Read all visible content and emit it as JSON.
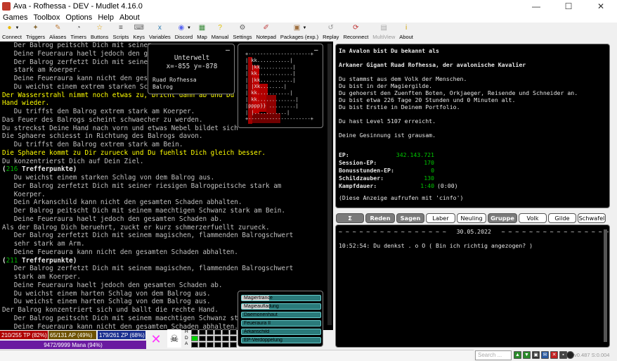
{
  "window": {
    "title": "Ava - Rofhessa - DEV - Mudlet 4.16.0",
    "controls": [
      "—",
      "☐",
      "✕"
    ]
  },
  "menu": [
    "Games",
    "Toolbox",
    "Options",
    "Help",
    "About"
  ],
  "toolbar": [
    {
      "label": "Connect",
      "icon": "plug-icon",
      "color": "#e8b800",
      "glyph": "●",
      "arrow": true
    },
    {
      "label": "Triggers",
      "icon": "trigger-icon",
      "color": "#8a6d3b",
      "glyph": "✦"
    },
    {
      "label": "Aliases",
      "icon": "alias-icon",
      "color": "#c08040",
      "glyph": "✎"
    },
    {
      "label": "Timers",
      "icon": "clock-icon",
      "color": "#555555",
      "glyph": "◔"
    },
    {
      "label": "Buttons",
      "icon": "buttons-icon",
      "color": "#e0a000",
      "glyph": "☆"
    },
    {
      "label": "Scripts",
      "icon": "scripts-icon",
      "color": "#444444",
      "glyph": "≡"
    },
    {
      "label": "Keys",
      "icon": "keys-icon",
      "color": "#6b6b6b",
      "glyph": "⌨"
    },
    {
      "label": "Variables",
      "icon": "variables-icon",
      "color": "#2a7ab0",
      "glyph": "x"
    },
    {
      "label": "Discord",
      "icon": "discord-icon",
      "color": "#5865f2",
      "glyph": "◉",
      "arrow": true
    },
    {
      "label": "Map",
      "icon": "map-icon",
      "color": "#3a8a3a",
      "glyph": "▦"
    },
    {
      "label": "Manual",
      "icon": "manual-icon",
      "color": "#e0c000",
      "glyph": "?"
    },
    {
      "label": "Settings",
      "icon": "settings-icon",
      "color": "#666666",
      "glyph": "⚙"
    },
    {
      "label": "Notepad",
      "icon": "notepad-icon",
      "color": "#c04040",
      "glyph": "✐"
    },
    {
      "label": "Packages (exp.)",
      "icon": "package-icon",
      "color": "#a07040",
      "glyph": "▣",
      "arrow": true
    },
    {
      "label": "Replay",
      "icon": "replay-icon",
      "color": "#999999",
      "glyph": "↺"
    },
    {
      "label": "Reconnect",
      "icon": "reconnect-icon",
      "color": "#c03030",
      "glyph": "⟳"
    },
    {
      "label": "MultiView",
      "icon": "multiview-icon",
      "color": "#aaaaaa",
      "glyph": "▤",
      "dim": true
    },
    {
      "label": "About",
      "icon": "about-icon",
      "color": "#d0a000",
      "glyph": "i"
    }
  ],
  "main_output": [
    {
      "t": "   Der Balrog peitscht Dich mit seinem",
      "c": "gray"
    },
    {
      "t": "   Deine Feueraura haelt jedoch den ges",
      "c": "gray"
    },
    {
      "t": "   Der Balrog zerfetzt Dich mit seinen",
      "c": "gray"
    },
    {
      "t": "   stark am Koerper.",
      "c": "gray"
    },
    {
      "t": "   Deine Feueraura kann nicht den gesam",
      "c": "gray"
    },
    {
      "t": "   Du weichst einem extrem starken Schl",
      "c": "gray"
    },
    {
      "t": "Der Wasserstrahl nimmt noch etwas zu, bricht dann ab und Du s",
      "c": "yellow"
    },
    {
      "t": "Hand wieder.",
      "c": "yellow"
    },
    {
      "t": "   Du triffst den Balrog extrem stark am Koerper.",
      "c": "gray"
    },
    {
      "t": "Das Feuer des Balrogs scheint schwaecher zu werden.",
      "c": "gray"
    },
    {
      "t": "Du streckst Deine Hand nach vorn und etwas Nebel bildet sich",
      "c": "gray"
    },
    {
      "t": "Die Sphaere schiesst in Richtung des Balrogs davon.",
      "c": "gray"
    },
    {
      "t": "   Du triffst den Balrog extrem stark am Bein.",
      "c": "gray"
    },
    {
      "t": "Die Sphaere kommt zu Dir zurueck und Du fuehlst Dich gleich besser.",
      "c": "yellow"
    },
    {
      "t": "Du konzentrierst Dich auf Dein Ziel.",
      "c": "gray"
    },
    {
      "t": "(216 Trefferpunkte)",
      "c": "tp"
    },
    {
      "t": "   Du weichst einem starken Schlag von dem Balrog aus.",
      "c": "gray"
    },
    {
      "t": "   Der Balrog zerfetzt Dich mit seiner riesigen Balrogpeitsche stark am",
      "c": "gray"
    },
    {
      "t": "   Koerper.",
      "c": "gray"
    },
    {
      "t": "   Dein Arkanschild kann nicht den gesamten Schaden abhalten.",
      "c": "gray"
    },
    {
      "t": "   Der Balrog peitscht Dich mit seinem maechtigen Schwanz stark am Bein.",
      "c": "gray"
    },
    {
      "t": "   Deine Feueraura haelt jedoch den gesamten Schaden ab.",
      "c": "gray"
    },
    {
      "t": "Als der Balrog Dich beruehrt, zuckt er kurz schmerzerfuellt zurueck.",
      "c": "gray"
    },
    {
      "t": "   Der Balrog zerfetzt Dich mit seinem magischen, flammenden Balrogschwert",
      "c": "gray"
    },
    {
      "t": "   sehr stark am Arm.",
      "c": "gray"
    },
    {
      "t": "   Deine Feueraura kann nicht den gesamten Schaden abhalten.",
      "c": "gray"
    },
    {
      "t": "(211 Trefferpunkte)",
      "c": "tp"
    },
    {
      "t": "   Der Balrog zerfetzt Dich mit seinem magischen, flammenden Balrogschwert",
      "c": "gray"
    },
    {
      "t": "   stark am Koerper.",
      "c": "gray"
    },
    {
      "t": "   Deine Feueraura haelt jedoch den gesamten Schaden ab.",
      "c": "gray"
    },
    {
      "t": "   Du weichst einem harten Schlag von dem Balrog aus.",
      "c": "gray"
    },
    {
      "t": "   Du weichst einem harten Schlag von dem Balrog aus.",
      "c": "gray"
    },
    {
      "t": "Der Balrog konzentriert sich und ballt die rechte Hand.",
      "c": "gray"
    },
    {
      "t": "   Der Balrog peitscht Dich mit seinem maechtigen Schwanz sta",
      "c": "gray"
    },
    {
      "t": "   Deine Feueraura kann nicht den gesamten Schaden abhalten.",
      "c": "gray"
    },
    {
      "t": "   Der Balrog peitscht Dich mit seinem maechtigen Schwanz sta",
      "c": "gray"
    }
  ],
  "mapinfo": {
    "area": "Unterwelt",
    "coords": "x=-855 y=-878",
    "room": "Ruad Rofhessa",
    "mob": "Balrog",
    "close": "–"
  },
  "map": {
    "close": "–",
    "rows": [
      "+---------------------+",
      "|                kk...........|",
      "|               |kk...........|",
      "|              kk............|",
      "|              |kk...........|",
      "|                |Xk........|",
      "|               kk...........|",
      "|              kk.............|",
      "|pppp}}  .........|",
      "|          |...........|",
      "+---------------------+"
    ]
  },
  "info": {
    "lines": [
      {
        "t": "In Avalon bist Du bekannt als",
        "b": true
      },
      {
        "t": "",
        "b": false
      },
      {
        "t": "Arkaner Gigant Ruad Rofhessa, der avalonische Kavalier",
        "b": true
      },
      {
        "t": "",
        "b": false
      },
      {
        "t": "Du stammst aus dem Volk der Menschen.",
        "b": false
      },
      {
        "t": "Du bist in der Magiergilde.",
        "b": false
      },
      {
        "t": "Du gehoerst den Zuenften Boten, Orkjaeger, Reisende und Schneider an.",
        "b": false
      },
      {
        "t": "Du bist etwa 226 Tage 20 Stunden und 0 Minuten alt.",
        "b": false
      },
      {
        "t": "Du bist Erstie in Deinem Portfolio.",
        "b": false
      },
      {
        "t": "",
        "b": false
      },
      {
        "t": "Du hast Level 5107 erreicht.",
        "b": false
      },
      {
        "t": "",
        "b": false
      },
      {
        "t": "Deine Gesinnung ist grausam.",
        "b": false
      }
    ],
    "stats": [
      {
        "k": "EP:",
        "v": "342.143.721",
        "x": ""
      },
      {
        "k": "Session-EP:",
        "v": "170",
        "x": ""
      },
      {
        "k": "Bonusstunden-EP:",
        "v": "0",
        "x": ""
      },
      {
        "k": "Schildzauber:",
        "v": "130",
        "x": ""
      },
      {
        "k": "Kampfdauer:",
        "v": "1:40",
        "x": "(0:00)"
      }
    ],
    "footer": "(Diese Anzeige aufrufen mit 'cinfo')"
  },
  "chat_tabs": [
    {
      "label": "Σ",
      "style": "gray"
    },
    {
      "label": "Reden",
      "style": "gray"
    },
    {
      "label": "Sagen",
      "style": "gray"
    },
    {
      "label": "Laber",
      "style": "white"
    },
    {
      "label": "Neuling",
      "style": "white"
    },
    {
      "label": "Gruppe",
      "style": "gray"
    },
    {
      "label": "Volk",
      "style": "white"
    },
    {
      "label": "Gilde",
      "style": "white"
    },
    {
      "label": "Schwafel",
      "style": "white"
    }
  ],
  "chat": {
    "dateline": "~ ~ ~ ~ ~ ~ ~ ~ ~ ~ ~ ~ ~ ~ ~ ~   30.05.2022   ~ ~ ~ ~ ~ ~ ~ ~ ~ ~ ~ ~ ~ ~ ~ ~",
    "message": "10:52:54: Du denkst . o O ( Bin ich richtig angezogen? )"
  },
  "status": {
    "tp": "210/255 TP (82%)",
    "ap": "65/131 AP (49%)",
    "zp": "179/261 ZP (68%)",
    "mana": "9472/9999 Mana (94%)",
    "hda": [
      "H",
      "D",
      "A"
    ]
  },
  "buffs": [
    {
      "name": "Magiertrance",
      "fill": 0.35
    },
    {
      "name": "Magieaufladung",
      "fill": 0.35
    },
    {
      "name": "Daemonenhaut",
      "fill": 0.0
    },
    {
      "name": "Feueraura II",
      "fill": 0.0
    },
    {
      "name": "Arkanschild",
      "fill": 0.0
    },
    {
      "name": "EP-Verdoppelung",
      "fill": 0.0
    }
  ],
  "bottom": {
    "search_placeholder": "Search ...",
    "version": "v0.487 S:0.004"
  },
  "colors": {
    "tp": "#b00000",
    "ap": "#6e5200",
    "zp": "#1a2f8f",
    "mana": "#6a1aa0",
    "highlight": "#ffff00",
    "stat_value": "#00c800"
  }
}
